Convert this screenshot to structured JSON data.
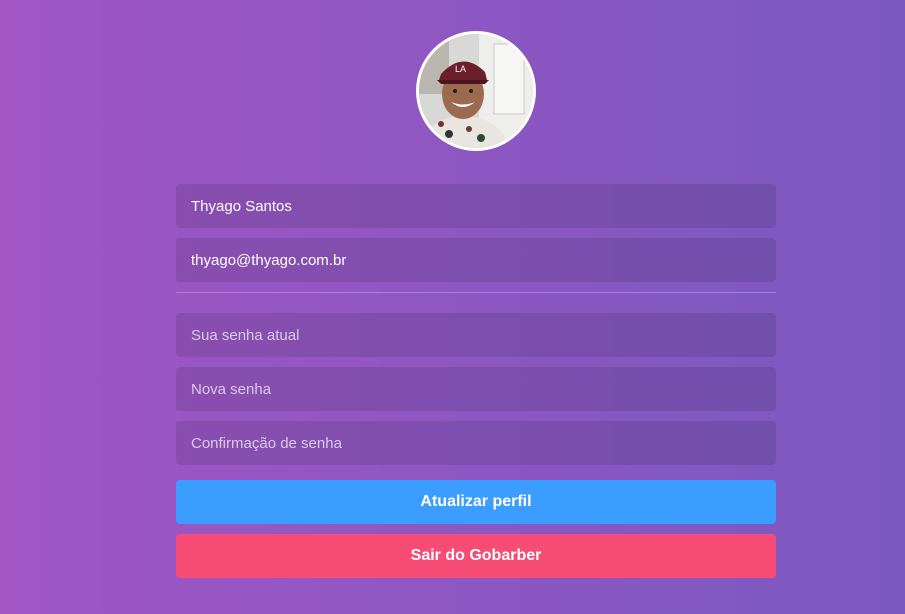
{
  "profile": {
    "avatar_icon": "user-photo"
  },
  "form": {
    "name_value": "Thyago Santos",
    "email_value": "thyago@thyago.com.br",
    "old_password_placeholder": "Sua senha atual",
    "new_password_placeholder": "Nova senha",
    "confirm_password_placeholder": "Confirmação de senha"
  },
  "buttons": {
    "update_label": "Atualizar perfil",
    "update_color": "#3b9eff",
    "logout_label": "Sair do Gobarber",
    "logout_color": "#f64c75"
  },
  "theme": {
    "gradient_start": "#a156c4",
    "gradient_end": "#7a58c0"
  }
}
